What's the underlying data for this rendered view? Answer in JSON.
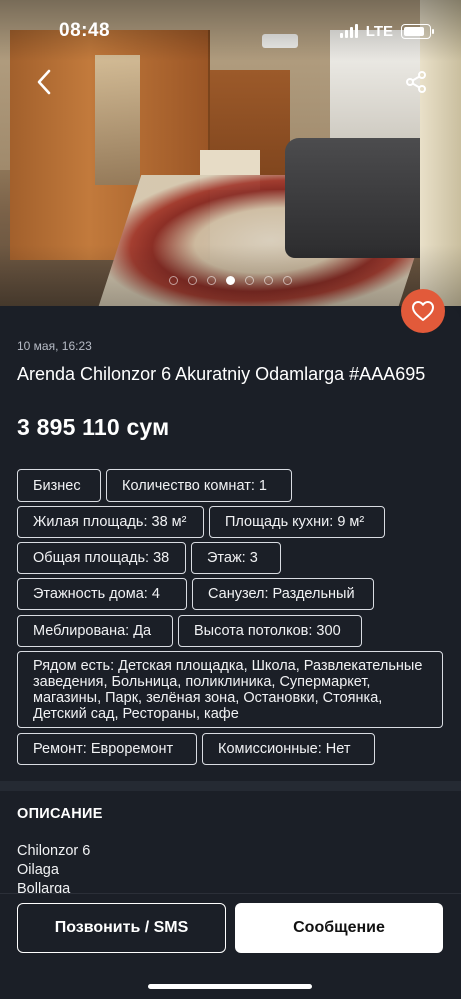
{
  "status_bar": {
    "time": "08:48",
    "network": "LTE",
    "battery_level": 0.85
  },
  "gallery": {
    "photo_count": 7,
    "active_index": 3
  },
  "listing": {
    "date": "10 мая, 16:23",
    "title": "Arenda Chilonzor 6 Akuratniy Odamlarga #AAA695",
    "price": "3 895 110 сум"
  },
  "params": [
    "Бизнес",
    "Количество комнат: 1",
    "Жилая площадь: 38 м²",
    "Площадь кухни: 9 м²",
    "Общая площадь: 38",
    "Этаж: 3",
    "Этажность дома: 4",
    "Санузел: Раздельный",
    "Меблирована: Да",
    "Высота потолков: 300",
    "Рядом есть: Детская площадка, Школа, Развлекательные заведения, Больница, поликлиника, Супермаркет, магазины, Парк, зелёная зона, Остановки, Стоянка, Детский сад, Рестораны, кафе",
    "Ремонт: Евроремонт",
    "Комиссионные: Нет"
  ],
  "description": {
    "heading": "ОПИСАНИЕ",
    "lines": [
      "Chilonzor 6",
      "Oilaga",
      "Bollarga"
    ]
  },
  "actions": {
    "call_label": "Позвонить / SMS",
    "message_label": "Сообщение"
  },
  "colors": {
    "background": "#1b1f27",
    "favorite": "#e25a3a"
  }
}
